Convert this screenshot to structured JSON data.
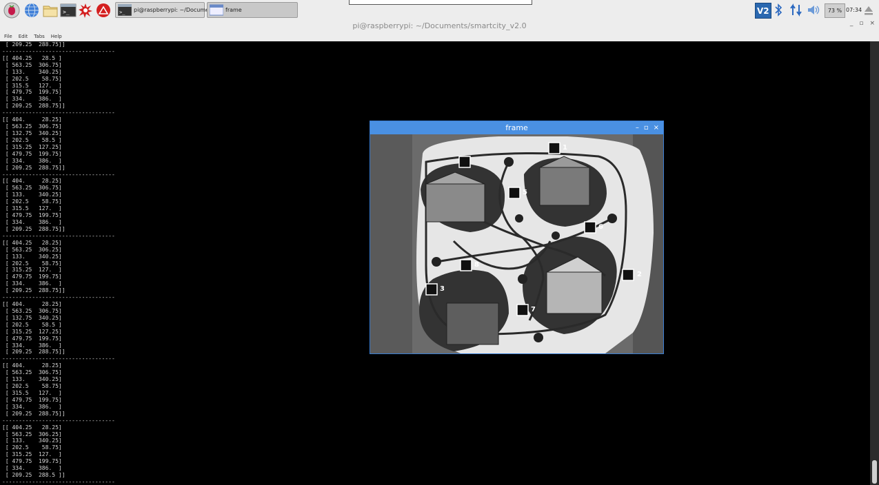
{
  "panel": {
    "launchers": [
      "raspberry-menu-icon",
      "web-browser-icon",
      "file-manager-icon",
      "terminal-icon",
      "mathematica-icon",
      "wolfram-icon"
    ],
    "tasks": [
      {
        "label": "pi@raspberrypi: ~/Documents...",
        "icon": "terminal-icon"
      },
      {
        "label": "frame",
        "icon": "window-icon"
      }
    ],
    "tray": {
      "vnc_label": "V2",
      "cpu": "73 %",
      "clock": "07:34"
    }
  },
  "terminal": {
    "title": "pi@raspberrypi: ~/Documents/smartcity_v2.0",
    "menu": [
      "File",
      "Edit",
      "Tabs",
      "Help"
    ],
    "controls": [
      "_",
      "▫",
      "×"
    ],
    "output": [
      " [ 209.25  288.75]]",
      "----------------------------------",
      "[[ 404.25   28.5 ]",
      " [ 563.25  306.75]",
      " [ 133.    340.25]",
      " [ 202.5    58.75]",
      " [ 315.5   127.  ]",
      " [ 479.75  199.75]",
      " [ 334.    386.  ]",
      " [ 209.25  288.75]]",
      "----------------------------------",
      "[[ 404.     28.25]",
      " [ 563.25  306.75]",
      " [ 132.75  340.25]",
      " [ 202.5    58.5 ]",
      " [ 315.25  127.25]",
      " [ 479.75  199.75]",
      " [ 334.    386.  ]",
      " [ 209.25  288.75]]",
      "----------------------------------",
      "[[ 404.     28.25]",
      " [ 563.25  306.75]",
      " [ 133.    340.25]",
      " [ 202.5    58.75]",
      " [ 315.5   127.  ]",
      " [ 479.75  199.75]",
      " [ 334.    386.  ]",
      " [ 209.25  288.75]]",
      "----------------------------------",
      "[[ 404.25   28.25]",
      " [ 563.25  306.25]",
      " [ 133.    340.25]",
      " [ 202.5    58.75]",
      " [ 315.25  127.  ]",
      " [ 479.75  199.75]",
      " [ 334.    386.  ]",
      " [ 209.25  288.75]]",
      "----------------------------------",
      "[[ 404.     28.25]",
      " [ 563.25  306.75]",
      " [ 132.75  340.25]",
      " [ 202.5    58.5 ]",
      " [ 315.25  127.25]",
      " [ 479.75  199.75]",
      " [ 334.    386.  ]",
      " [ 209.25  288.75]]",
      "----------------------------------",
      "[[ 404.     28.25]",
      " [ 563.25  306.75]",
      " [ 133.    340.25]",
      " [ 202.5    58.75]",
      " [ 315.5   127.  ]",
      " [ 479.75  199.75]",
      " [ 334.    386.  ]",
      " [ 209.25  288.75]]",
      "----------------------------------",
      "[[ 404.25   28.25]",
      " [ 563.25  306.25]",
      " [ 133.    340.25]",
      " [ 202.5    58.75]",
      " [ 315.25  127.  ]",
      " [ 479.75  199.75]",
      " [ 334.    386.  ]",
      " [ 209.25  288.5 ]]",
      "----------------------------------"
    ]
  },
  "frame_window": {
    "title": "frame",
    "controls": [
      "–",
      "▫",
      "×"
    ],
    "markers": [
      "1",
      "2",
      "3",
      "5",
      "6",
      "7",
      "8"
    ]
  }
}
